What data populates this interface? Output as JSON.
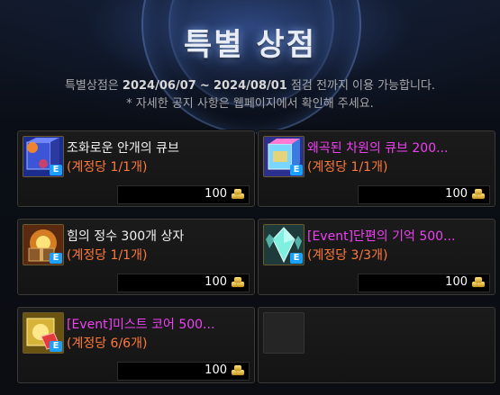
{
  "header": {
    "title": "특별 상점",
    "notice_prefix": "특별상점은",
    "start_date": "2024/06/07",
    "date_sep": "~",
    "end_date": "2024/08/01",
    "notice_suffix": "점검 전까지 이용 가능합니다.",
    "notice_line2": "* 자세한 공지 사항은 웹페이지에서 확인해 주세요."
  },
  "items": [
    {
      "name": "조화로운 안개의 큐브",
      "limit": "(계정당 1/1개)",
      "price": "100",
      "name_color": "white",
      "icon": "cube-icon"
    },
    {
      "name": "왜곡된 차원의 큐브 200...",
      "limit": "(계정당 1/1개)",
      "price": "100",
      "name_color": "pink",
      "icon": "cube-icon"
    },
    {
      "name": "힘의 정수 300개 상자",
      "limit": "(계정당 1/1개)",
      "price": "100",
      "name_color": "white",
      "icon": "box-icon"
    },
    {
      "name": "[Event]단편의 기억 500...",
      "limit": "(계정당 3/3개)",
      "price": "100",
      "name_color": "pink",
      "icon": "crystal-icon"
    },
    {
      "name": "[Event]미스트 코어 500...",
      "limit": "(계정당 6/6개)",
      "price": "100",
      "name_color": "pink",
      "icon": "core-icon"
    }
  ],
  "currency_icon": "coin-icon",
  "badge_letter": "E"
}
